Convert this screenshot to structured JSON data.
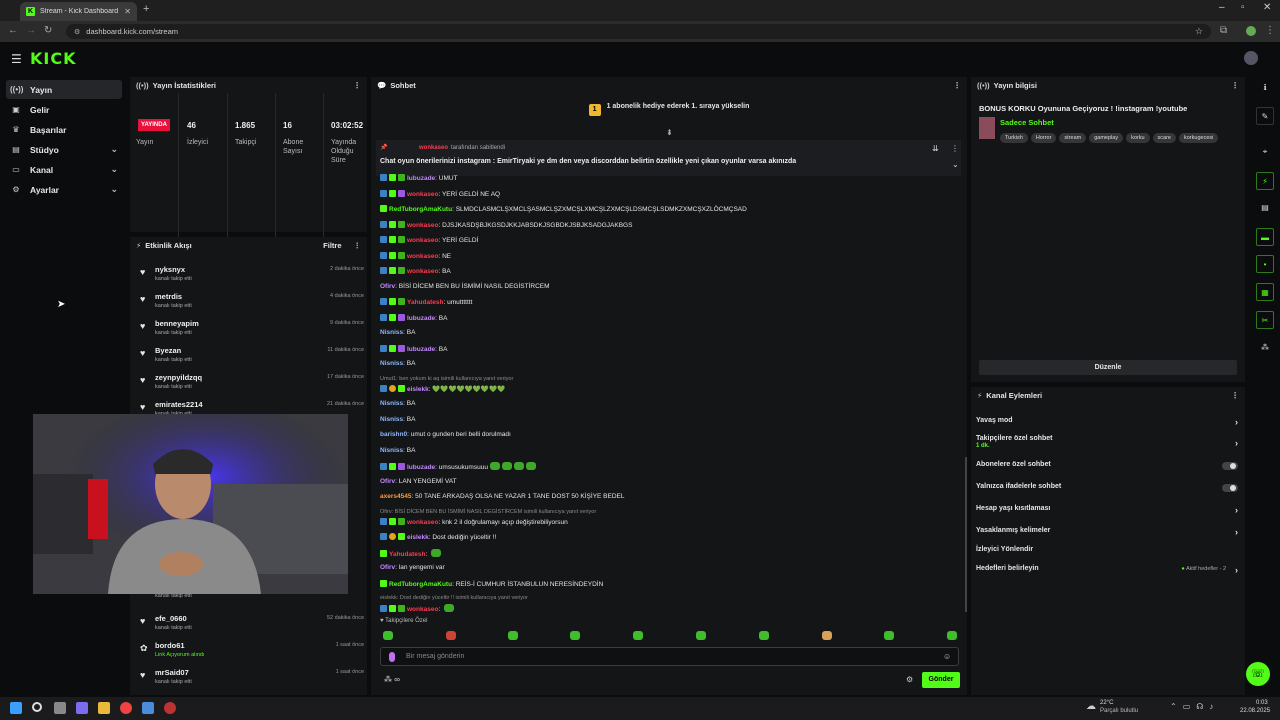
{
  "browser": {
    "tab_title": "Stream - Kick Dashboard",
    "url": "dashboard.kick.com/stream"
  },
  "brand": {
    "logo": "KICK",
    "accent": "#53fc18"
  },
  "sidebar": {
    "items": [
      {
        "label": "Yayın",
        "icon": "broadcast-icon",
        "active": true
      },
      {
        "label": "Gelir",
        "icon": "wallet-icon"
      },
      {
        "label": "Başarılar",
        "icon": "trophy-icon"
      },
      {
        "label": "Stüdyo",
        "icon": "studio-icon",
        "expandable": true
      },
      {
        "label": "Kanal",
        "icon": "channel-icon",
        "expandable": true
      },
      {
        "label": "Ayarlar",
        "icon": "gear-icon",
        "expandable": true
      }
    ]
  },
  "stats": {
    "title": "Yayın İstatistikleri",
    "live_badge": "YAYINDA",
    "live_label": "Yayın",
    "viewers": "46",
    "viewers_label": "İzleyici",
    "followers": "1.865",
    "followers_label": "Takipçi",
    "subs": "16",
    "subs_label": "Abone Sayısı",
    "uptime": "03:02:52",
    "uptime_label": "Yayında Olduğu Süre"
  },
  "activity": {
    "title": "Etkinlik Akışı",
    "filter": "Filtre",
    "items": [
      {
        "name": "nyksnyx",
        "sub": "kanalı takip etti",
        "time": "2 dakika önce"
      },
      {
        "name": "metrdis",
        "sub": "kanalı takip etti",
        "time": "4 dakika önce"
      },
      {
        "name": "benneyapim",
        "sub": "kanalı takip etti",
        "time": "9 dakika önce"
      },
      {
        "name": "Byezan",
        "sub": "kanalı takip etti",
        "time": "11 dakika önce"
      },
      {
        "name": "zeynpyildzqq",
        "sub": "kanalı takip etti",
        "time": "17 dakika önce"
      },
      {
        "name": "emirates2214",
        "sub": "kanalı takip etti",
        "time": "21 dakika önce"
      },
      {
        "name": "efe_0660",
        "sub": "kanalı takip etti",
        "time": "52 dakika önce"
      },
      {
        "name": "bordo61",
        "sub": "Link Açıyorum alındı",
        "time": "1 saat önce"
      },
      {
        "name": "mrSaid07",
        "sub": "kanalı takip etti",
        "time": "1 saat önce"
      }
    ],
    "hidden_follow_label": "kanalı takip etti"
  },
  "chat": {
    "title": "Sohbet",
    "goal": "1 abonelik hediye ederek 1. sıraya yükselin",
    "pinned_by": "tarafından sabitlendi",
    "pinned_text": "Chat oyun önerilerinizi instagram : EmirTiryaki ye dm den veya discorddan belirtin özellikle yeni çıkan oyunlar varsa akınızda",
    "messages": [
      {
        "user": "lubuzade",
        "cls": "u-purple",
        "text": "UMUT"
      },
      {
        "user": "wonkaseo",
        "cls": "u-red",
        "text": "YERİ GELDİ NE AQ"
      },
      {
        "user": "RedTuborgAmaKutu",
        "cls": "u-green",
        "text": "SLMDCLASMCLŞXMCLŞASMCLŞZXMCŞLXMCŞLZXMCŞLDSMCŞLSDMKZXMCŞXZLÖCMÇSAD"
      },
      {
        "user": "wonkaseo",
        "cls": "u-red",
        "text": "DJSJKASDŞBJKGSDJKKJABSDKJSGBDKJSBJKSADGJAKBGS"
      },
      {
        "user": "wonkaseo",
        "cls": "u-red",
        "text": "YERİ GELDİ"
      },
      {
        "user": "wonkaseo",
        "cls": "u-red",
        "text": "NE"
      },
      {
        "user": "wonkaseo",
        "cls": "u-red",
        "text": "BA"
      },
      {
        "user": "Ofirv",
        "cls": "u-purple",
        "text": "BİSİ DİCEM BEN BU İSMİMİ NASIL DEGİSTİRCEM"
      },
      {
        "user": "Yahudatesh",
        "cls": "u-red",
        "text": "umuttttttt"
      },
      {
        "user": "lubuzade",
        "cls": "u-purple",
        "text": "BA"
      },
      {
        "user": "Nisniss",
        "cls": "u-blue",
        "text": "BA"
      },
      {
        "user": "lubuzade",
        "cls": "u-purple",
        "text": "BA"
      },
      {
        "user": "Nisniss",
        "cls": "u-blue",
        "text": "BA"
      },
      {
        "reply": "Umut1: ben yokum ki aq isimili kullanıcıya yanıt veriyor"
      },
      {
        "user": "eislekk",
        "cls": "u-purple",
        "text": "💚💚💚💚💚💚💚💚💚"
      },
      {
        "user": "Nisniss",
        "cls": "u-blue",
        "text": "BA"
      },
      {
        "user": "Nisniss",
        "cls": "u-blue",
        "text": "BA"
      },
      {
        "user": "barishn0",
        "cls": "u-blue",
        "text": "umut o gunden beri belli dorulmadı"
      },
      {
        "user": "Nisniss",
        "cls": "u-blue",
        "text": "BA"
      },
      {
        "user": "lubuzade",
        "cls": "u-purple",
        "text": "umsusukumsuuu"
      },
      {
        "user": "Ofirv",
        "cls": "u-purple",
        "text": "LAN YENGEMİ VAT"
      },
      {
        "user": "axers4545",
        "cls": "u-orange",
        "text": "50 TANE ARKADAŞ OLSA NE YAZAR 1 TANE DOST 50 KİŞİYE BEDEL"
      },
      {
        "reply": "Ofirv: BİSİ DİCEM BEN BU İSMİMİ NASIL DEGİSTİRCEM isimili kullanıcıya yanıt veriyor"
      },
      {
        "user": "wonkaseo",
        "cls": "u-red",
        "text": "knk 2 il doğrulamayı açıp değiştirebiliyorsun"
      },
      {
        "user": "eislekk",
        "cls": "u-purple",
        "text": "Dost dediğin yüceltir !!"
      },
      {
        "user": "Yahudatesh",
        "cls": "u-red",
        "text": ""
      },
      {
        "user": "Ofirv",
        "cls": "u-purple",
        "text": "lan yengemi var"
      },
      {
        "user": "RedTuborgAmaKutu",
        "cls": "u-green",
        "text": "REİS-İ CUMHUR İSTANBULUN NERESİNDEYDİN"
      },
      {
        "reply": "eislekk: Dost dediğin yüceltir !! isimili kullanıcıya yanıt veriyor"
      },
      {
        "user": "wonkaseo",
        "cls": "u-red",
        "text": ""
      }
    ],
    "followers_only": "Takipçilere Özel",
    "input_placeholder": "Bir mesaj gönderin",
    "send": "Gönder"
  },
  "stream_info": {
    "title": "Yayın bilgisi",
    "stream_title": "BONUS KORKU Oyununa Geçiyoruz ! !instagram !youtube",
    "category": "Sadece Sohbet",
    "tags": [
      "Turkish",
      "Horror",
      "stream",
      "gameplay",
      "korku",
      "scare",
      "korkugecesi"
    ],
    "edit": "Düzenle"
  },
  "channel_actions": {
    "title": "Kanal Eylemleri",
    "slow_mode": "Yavaş mod",
    "followers_chat": "Takipçilere özel sohbet",
    "followers_chat_sub": "1 dk.",
    "subs_chat": "Abonelere özel sohbet",
    "emote_chat": "Yalnızca ifadelerle sohbet",
    "age_limit": "Hesap yaşı kısıtlaması",
    "banned_words": "Yasaklanmış kelimeler",
    "redirect": "İzleyici Yönlendir",
    "goals": "Hedefleri belirleyin",
    "goals_status": "Aktif hedefler - 2"
  },
  "taskbar": {
    "weather_temp": "22°C",
    "weather_desc": "Parçalı bulutlu",
    "time": "0:03",
    "date": "22.08.2025"
  }
}
